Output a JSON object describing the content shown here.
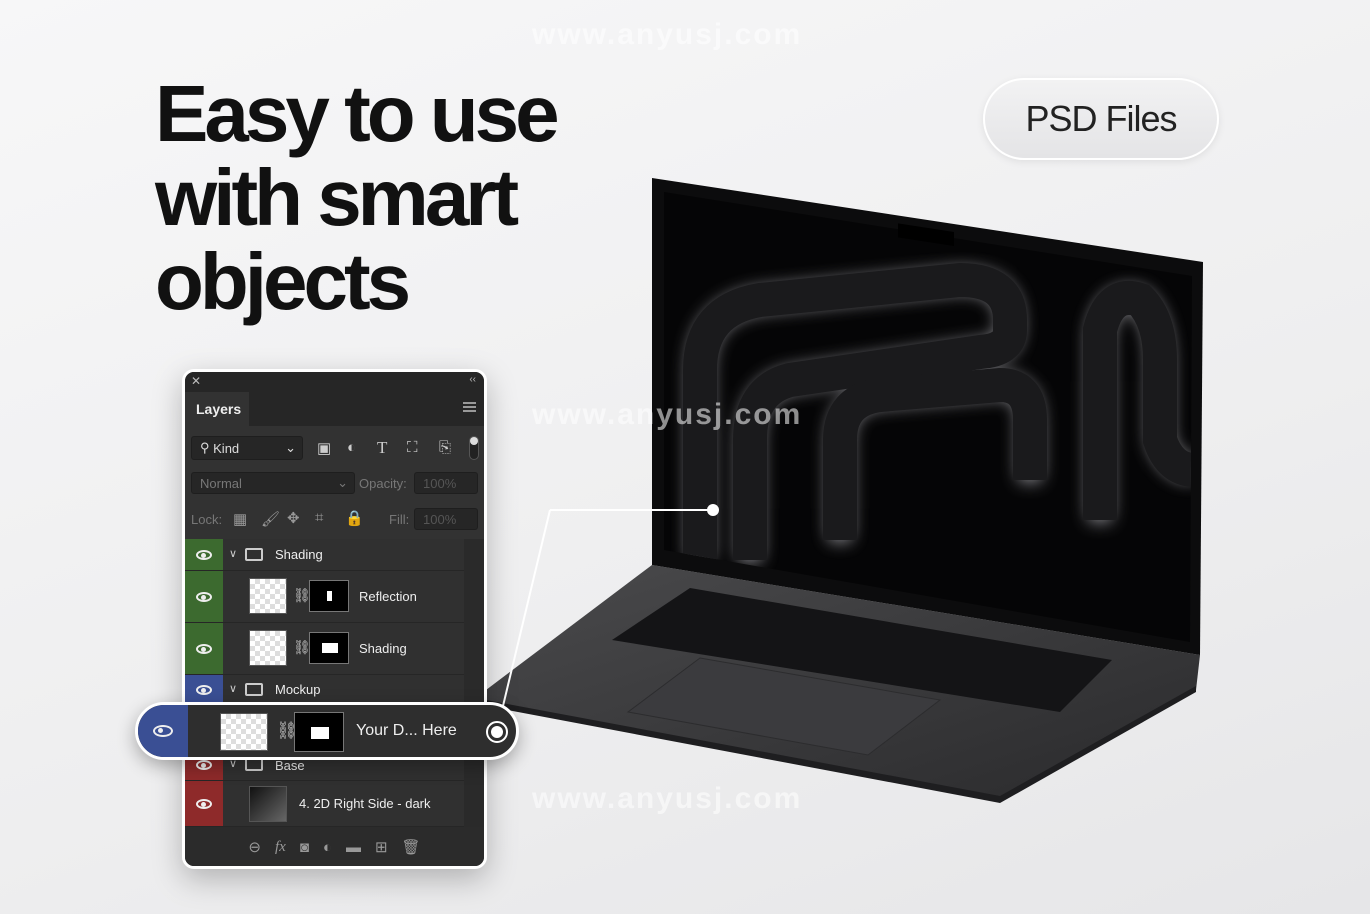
{
  "headline": [
    "Easy to use",
    "with smart",
    "objects"
  ],
  "badge": "PSD Files",
  "watermark": "www.anyusj.com",
  "layers_panel": {
    "tab": "Layers",
    "filter": {
      "label": "Kind"
    },
    "blend_mode": "Normal",
    "opacity_label": "Opacity:",
    "opacity": "100%",
    "lock_label": "Lock:",
    "fill_label": "Fill:",
    "fill": "100%",
    "layers": [
      {
        "name": "Shading",
        "type": "group",
        "color": "#3c6a2f"
      },
      {
        "name": "Reflection",
        "type": "layer",
        "color": "#3c6a2f"
      },
      {
        "name": "Shading",
        "type": "layer",
        "color": "#3c6a2f"
      },
      {
        "name": "Mockup",
        "type": "group",
        "color": "#3a4f94"
      },
      {
        "name": "Your D... Here",
        "type": "smart-object",
        "color": "#3a4f94",
        "selected": true
      },
      {
        "name": "Base",
        "type": "group",
        "color": "#8e2a2a"
      },
      {
        "name": "4. 2D Right Side - dark",
        "type": "smart-object",
        "color": "#8e2a2a"
      }
    ]
  }
}
